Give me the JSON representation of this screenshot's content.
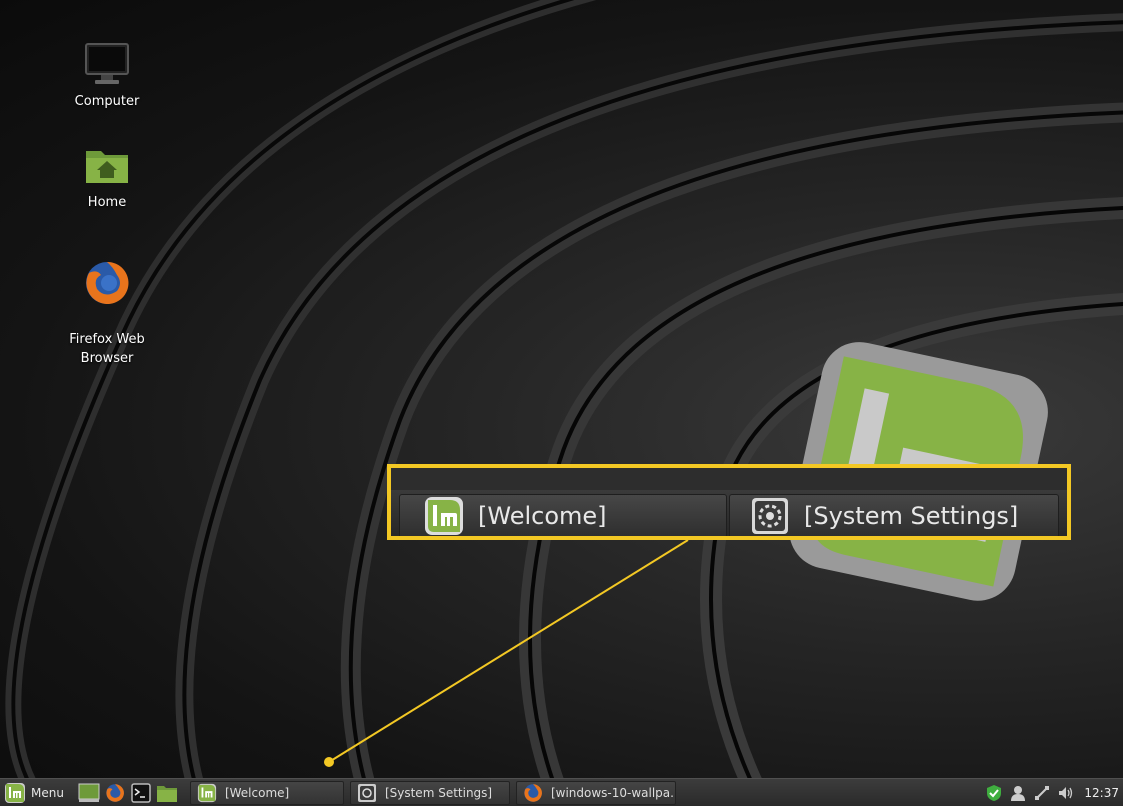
{
  "desktop": {
    "icons": [
      {
        "label": "Computer",
        "icon": "monitor-icon"
      },
      {
        "label": "Home",
        "icon": "home-folder-icon"
      },
      {
        "label": "Firefox Web\nBrowser",
        "icon": "firefox-icon"
      }
    ]
  },
  "callout": {
    "buttons": [
      {
        "label": "[Welcome]",
        "icon": "mint-logo-icon"
      },
      {
        "label": "[System Settings]",
        "icon": "system-settings-icon"
      }
    ],
    "highlight_color": "#f3c824"
  },
  "taskbar": {
    "menu_label": "Menu",
    "launchers": [
      "show-desktop-icon",
      "firefox-icon",
      "terminal-icon",
      "files-icon"
    ],
    "tasks": [
      {
        "label": "[Welcome]",
        "icon": "mint-logo-icon"
      },
      {
        "label": "[System Settings]",
        "icon": "system-settings-icon"
      },
      {
        "label": "[windows-10-wallpa...",
        "icon": "firefox-icon"
      }
    ],
    "tray": [
      "shield-check-icon",
      "user-icon",
      "network-icon",
      "volume-icon"
    ],
    "clock": "12:37"
  },
  "colors": {
    "mint_green": "#87b346",
    "accent_yellow": "#f3c824"
  }
}
